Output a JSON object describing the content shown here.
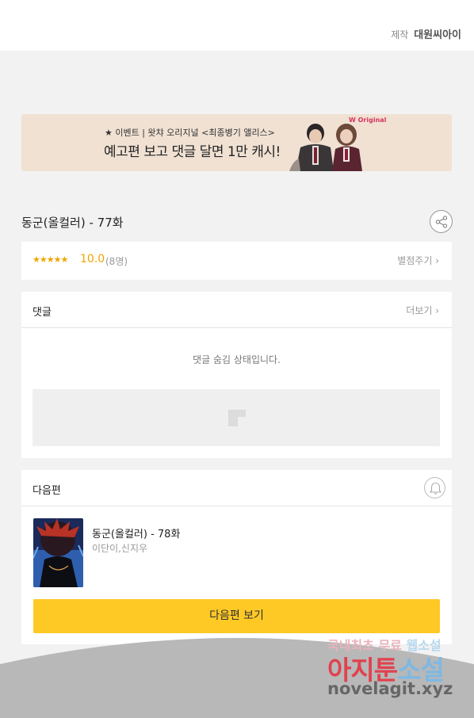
{
  "header": {
    "producer_label": "제작",
    "producer_name": "대원씨아이"
  },
  "banner": {
    "line1": "★ 이벤트 | 왓챠 오리지널 <최종병기 앨리스>",
    "line2": "예고편 보고 댓글 달면 1만 캐시!",
    "badge": "W Original"
  },
  "episode": {
    "title": "동군(올컬러) - 77화"
  },
  "rating": {
    "stars": "★★★★★",
    "score": "10.0",
    "count": "(8명)",
    "rate_label": "별점주기 ›"
  },
  "comments": {
    "title": "댓글",
    "more_label": "더보기 ›",
    "hidden_message": "댓글 숨김 상태입니다."
  },
  "next": {
    "title": "다음편",
    "episode_title": "동군(올컬러) - 78화",
    "authors": "이단이,신지우",
    "button_label": "다음편 보기"
  },
  "watermark": {
    "line1_a": "국내최초 무료 ",
    "line1_b": "웹소설",
    "line2_a": "아지툰",
    "line2_b": "소설",
    "line3": "novelagit.xyz"
  },
  "colors": {
    "accent": "#fec925",
    "star": "#f0a500",
    "banner_bg": "#f0e1d3"
  },
  "icons": [
    "share-icon",
    "bell-icon",
    "ad-placeholder-icon"
  ]
}
